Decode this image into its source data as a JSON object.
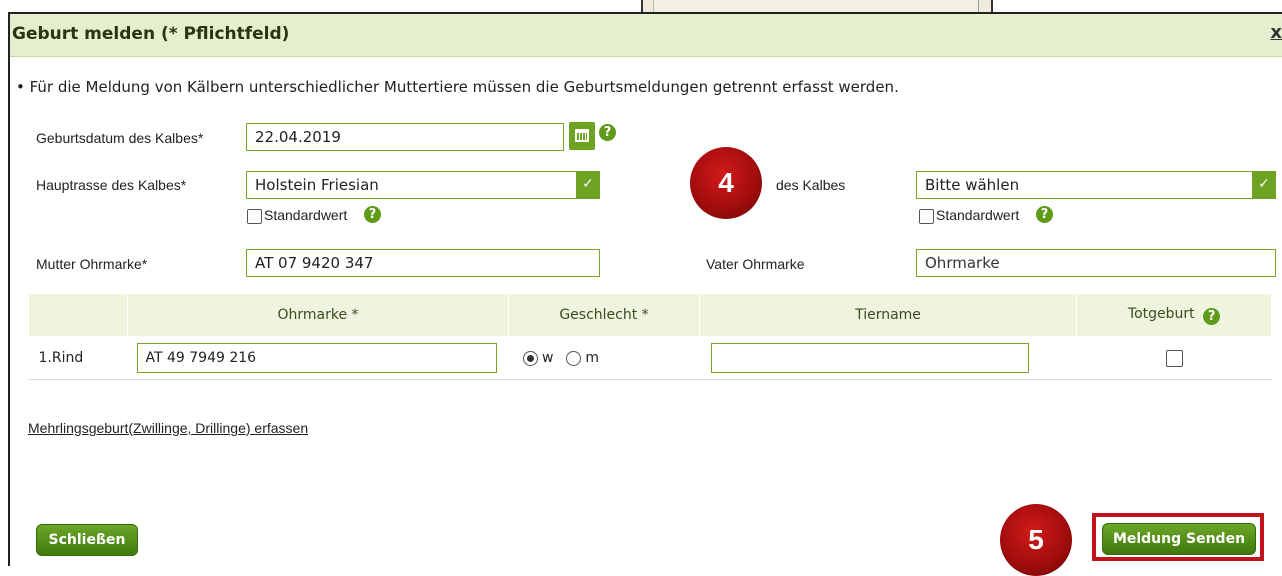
{
  "dialog": {
    "title": "Geburt melden (* Pflichtfeld)",
    "close": "x",
    "info": "• Für die Meldung von Kälbern unterschiedlicher Muttertiere müssen die Geburtsmeldungen getrennt erfasst werden."
  },
  "form": {
    "birthdate_label": "Geburtsdatum des Kalbes*",
    "birthdate_value": "22.04.2019",
    "mainbreed_label": "Hauptrasse des Kalbes*",
    "mainbreed_value": "Holstein Friesian",
    "standard_label": "Standardwert",
    "secondbreed_label_partial": "des Kalbes",
    "secondbreed_value": "Bitte wählen",
    "mother_label": "Mutter Ohrmarke*",
    "mother_value": "AT 07 9420 347",
    "father_label": "Vater Ohrmarke",
    "father_placeholder": "Ohrmarke"
  },
  "table": {
    "headers": [
      "",
      "Ohrmarke *",
      "Geschlecht *",
      "Tiername",
      "Totgeburt"
    ],
    "rows": [
      {
        "label": "1.Rind",
        "ohrmarke": "AT 49 7949 216",
        "sex_w": "w",
        "sex_m": "m",
        "sex_selected": "w",
        "tiername": "",
        "totgeburt": false
      }
    ]
  },
  "links": {
    "multiple_birth": "Mehrlingsgeburt(Zwillinge, Drillinge) erfassen"
  },
  "buttons": {
    "close": "Schließen",
    "send": "Meldung Senden"
  },
  "annotations": {
    "badge_4": "4",
    "badge_5": "5"
  },
  "colors": {
    "accent": "#6ea223",
    "title_bg": "#e5efcf",
    "badge": "#b01010",
    "highlight_box": "#c0141c"
  },
  "icons": {
    "help": "?",
    "calendar": "calendar-icon",
    "dropdown": "chevron-down-icon"
  }
}
